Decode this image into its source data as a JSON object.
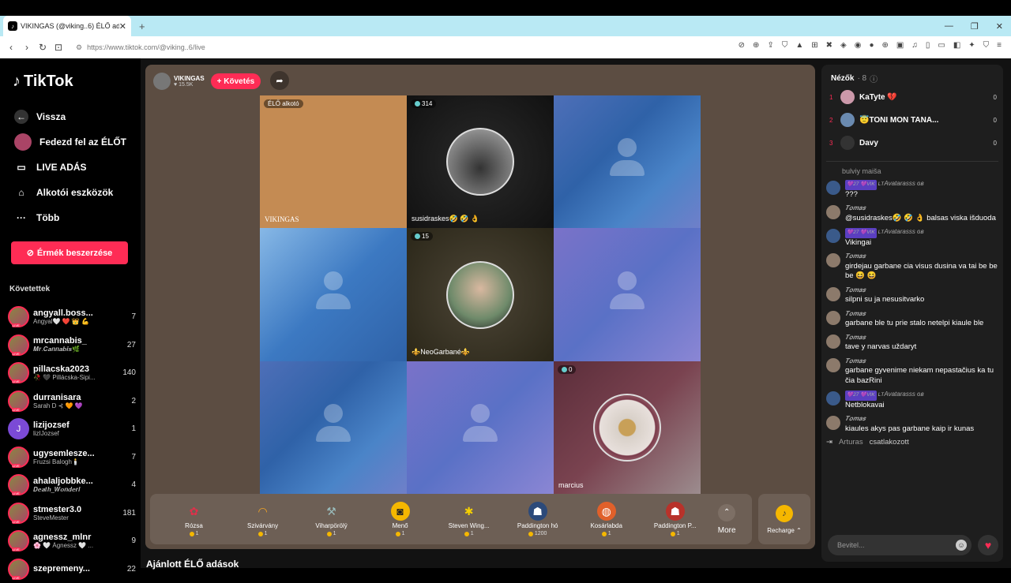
{
  "browser": {
    "tab_title": "VIKINGAS (@viking..6) ÉLŐ ad...",
    "url": "https://www.tiktok.com/@viking..6/live"
  },
  "sidebar": {
    "logo": "TikTok",
    "menu": [
      {
        "icon": "arrow-left-icon",
        "label": "Vissza"
      },
      {
        "icon": "avatar-icon",
        "label": "Fedezd fel az ÉLŐT"
      },
      {
        "icon": "video-camera-icon",
        "label": "LIVE ADÁS"
      },
      {
        "icon": "creator-tools-icon",
        "label": "Alkotói eszközök"
      },
      {
        "icon": "more-dots-icon",
        "label": "Több"
      }
    ],
    "coins_button": "Érmék beszerzése",
    "following_header": "Követettek",
    "following": [
      {
        "name": "angyall.boss...",
        "sub": "Angyal🤍 ❤️ 👑 💪",
        "count": "7"
      },
      {
        "name": "mrcannabis_",
        "sub": "𝑴𝒓.𝑪𝒂𝒏𝒏𝒂𝒃𝒊𝒔🌿",
        "count": "27"
      },
      {
        "name": "pillacska2023",
        "sub": "🥀 🖤 Pillácska-Sipi...",
        "count": "140"
      },
      {
        "name": "durranisara",
        "sub": "Sarah D ⊰ 🧡 💜",
        "count": "2"
      },
      {
        "name": "lizijozsef",
        "sub": "lizIJozsef",
        "count": "1"
      },
      {
        "name": "ugysemlesze...",
        "sub": "Fruzsi Balogh🕯️",
        "count": "7"
      },
      {
        "name": "ahalaljobbke...",
        "sub": "𝑫𝒆𝒂𝒕𝒉_𝑾𝒐𝒏𝒅𝒆𝒓𝒍",
        "count": "4"
      },
      {
        "name": "stmester3.0",
        "sub": "SteveMester",
        "count": "181"
      },
      {
        "name": "agnessz_mlnr",
        "sub": "🌸 🤍 Ágnessz 🤍 ...",
        "count": "9"
      },
      {
        "name": "szepremeny...",
        "sub": "",
        "count": "22"
      }
    ]
  },
  "stage": {
    "host_name": "VIKINGAS",
    "host_likes": "♥ 15.5K",
    "follow_label": "+ Követés",
    "cells": [
      {
        "badge": "ÉLŐ alkotó",
        "label": "VIKINGAS"
      },
      {
        "count": "314",
        "label": "susidraskes🤣 🤣 👌"
      },
      {
        "count": "",
        "label": ""
      },
      {
        "count": "",
        "label": ""
      },
      {
        "count": "15",
        "label": "⚜️NeoGarbané⚜️"
      },
      {
        "count": "",
        "label": ""
      },
      {
        "count": "",
        "label": ""
      },
      {
        "count": "",
        "label": ""
      },
      {
        "count": "0",
        "label": "marcius"
      }
    ],
    "gifts": [
      {
        "icon": "rose-icon",
        "name": "Rózsa",
        "price": "1"
      },
      {
        "icon": "rainbow-icon",
        "name": "Szivárvány",
        "price": "1"
      },
      {
        "icon": "cyclone-icon",
        "name": "Viharpörölý",
        "price": "1"
      },
      {
        "icon": "sunglasses-icon",
        "name": "Menő",
        "price": "1"
      },
      {
        "icon": "bee-icon",
        "name": "Steven Wing...",
        "price": "1"
      },
      {
        "icon": "paddington-icon",
        "name": "Paddington hó",
        "price": "1200"
      },
      {
        "icon": "basketball-icon",
        "name": "Kosárlabda",
        "price": "1"
      },
      {
        "icon": "paddington-icon",
        "name": "Paddington P...",
        "price": "1"
      }
    ],
    "more_label": "More",
    "recharge_label": "Recharge ⌃"
  },
  "recommended": "Ajánlott ÉLŐ adások",
  "chat": {
    "viewers_label": "Nézők",
    "viewers_count": "· 8",
    "viewers": [
      {
        "rank": "1",
        "name": "KaTyte 💔",
        "score": "0"
      },
      {
        "rank": "2",
        "name": "😇TONI MON TANA...",
        "score": "0"
      },
      {
        "rank": "3",
        "name": "Davy",
        "score": "0"
      }
    ],
    "partial_line": "bulviy maiša",
    "messages": [
      {
        "user": "ʟᴛAvatarasss ɢʙ",
        "badges": "💜27 💜VIK",
        "text": "???"
      },
      {
        "user": "𝑻𝒐𝒎𝒂𝒔",
        "badges": "",
        "text": "@susidraskes🤣 🤣 👌 balsas viska išduoda"
      },
      {
        "user": "ʟᴛAvatarasss ɢʙ",
        "badges": "💜27 💜VIK",
        "text": "Vikingai"
      },
      {
        "user": "𝑻𝒐𝒎𝒂𝒔",
        "badges": "",
        "text": "girdejau garbane cia visus dusina va tai be be be 😆 😆"
      },
      {
        "user": "𝑻𝒐𝒎𝒂𝒔",
        "badges": "",
        "text": "silpni su ja nesusitvarko"
      },
      {
        "user": "𝑻𝒐𝒎𝒂𝒔",
        "badges": "",
        "text": "garbane ble tu prie stalo netelpi kiaule ble"
      },
      {
        "user": "𝑻𝒐𝒎𝒂𝒔",
        "badges": "",
        "text": "tave y narvas uždaryt"
      },
      {
        "user": "𝑻𝒐𝒎𝒂𝒔",
        "badges": "",
        "text": "garbane gyvenime niekam nepastačius ka tu čia bazRini"
      },
      {
        "user": "ʟᴛAvatarasss ɢʙ",
        "badges": "💜27 💜VIK",
        "text": "Netblokavai"
      },
      {
        "user": "𝑻𝒐𝒎𝒂𝒔",
        "badges": "",
        "text": "kiaules akys pas garbane kaip ir kunas"
      }
    ],
    "join_name": "Arturas",
    "join_text": "csatlakozott",
    "input_placeholder": "Bevitel..."
  },
  "colors": {
    "brand": "#fe2c55",
    "stage_bg": "#5c4d42",
    "coin": "#f5b700"
  }
}
